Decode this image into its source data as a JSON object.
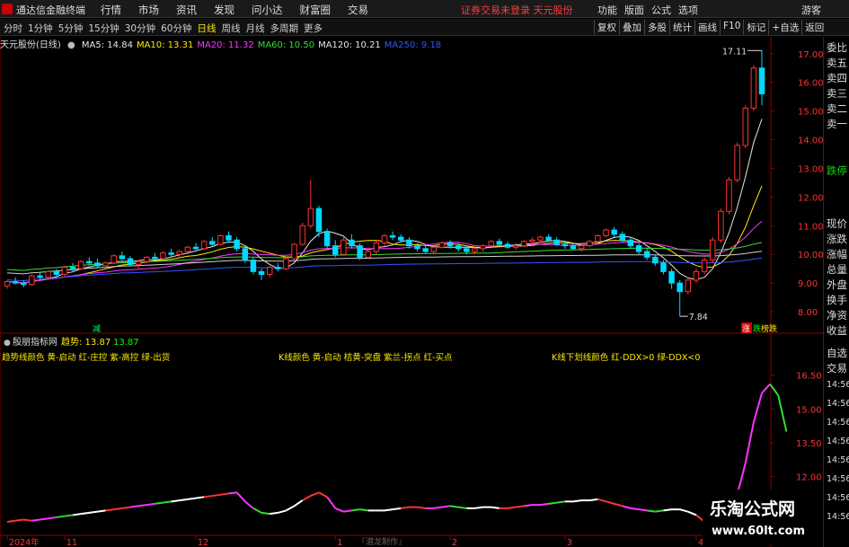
{
  "titlebar": {
    "app_name": "通达信金融终端",
    "menu": [
      "行情",
      "市场",
      "资讯",
      "发现",
      "问小达",
      "财富圈",
      "交易"
    ],
    "notice": "证券交易未登录 天元股份",
    "right_menu": [
      "功能",
      "版面",
      "公式",
      "选项"
    ],
    "guest": "游客"
  },
  "periodbar": {
    "periods": [
      "分时",
      "1分钟",
      "5分钟",
      "15分钟",
      "30分钟",
      "60分钟",
      "日线",
      "周线",
      "月线",
      "多周期",
      "更多"
    ],
    "active_period": "日线",
    "right_buttons": [
      "复权",
      "叠加",
      "多股",
      "统计",
      "画线",
      "F10",
      "标记",
      "+自选",
      "返回"
    ]
  },
  "main_header": {
    "stock": "天元股份(日线)",
    "ma": [
      {
        "label": "MA5: 14.84",
        "color": "#e6e6e6"
      },
      {
        "label": "MA10: 13.31",
        "color": "#ffea00"
      },
      {
        "label": "MA20: 11.32",
        "color": "#ff33ff"
      },
      {
        "label": "MA60: 10.50",
        "color": "#33dd33"
      },
      {
        "label": "MA120: 10.21",
        "color": "#e6e6e6"
      },
      {
        "label": "MA250: 9.18",
        "color": "#3355ff"
      }
    ]
  },
  "price_axis": {
    "ticks": [
      "17.00",
      "16.00",
      "15.00",
      "14.00",
      "13.00",
      "12.00",
      "11.00",
      "10.00",
      "9.00",
      "8.00"
    ],
    "high_label": "17.11",
    "low_label": "7.84"
  },
  "price_chart_labels": {
    "bottom_marker": "减",
    "tags": [
      "涨",
      "跌",
      "榜跌"
    ]
  },
  "indicator": {
    "header_name": "殷朋指标网",
    "trend_label": "趋势: 13.87",
    "trend_value2": "13.87",
    "legend1": "趋势线颜色 黄-启动 红-庄控 紫-高控 绿-出货",
    "legend2": "K线颜色 黄-启动 桔黄-突盘 紫兰-拐点 红-买点",
    "legend3": "K线下划线颜色 红-DDX>0 绿-DDX<0",
    "ticks": [
      "16.50",
      "15.00",
      "13.50",
      "12.00",
      "10.50"
    ],
    "watermark": "『潜龙制作』"
  },
  "date_axis": {
    "labels": [
      "2024年",
      "11",
      "12",
      "1",
      "2",
      "3",
      "4"
    ]
  },
  "side_panel": {
    "top": [
      "委比",
      "卖五",
      "卖四",
      "卖三",
      "卖二",
      "卖一"
    ],
    "mid": "跌停",
    "stats": [
      "现价",
      "涨跌",
      "涨幅",
      "总量",
      "外盘",
      "换手",
      "净资",
      "收益"
    ],
    "lower": [
      "自选",
      "交易"
    ],
    "times": [
      "14:56",
      "14:56",
      "14:56",
      "14:56",
      "14:56",
      "14:56",
      "14:56",
      "14:56"
    ]
  },
  "site_watermark": {
    "name": "乐淘公式网",
    "url": "www.60lt.com"
  },
  "chart_data": {
    "type": "candlestick",
    "dates_start": "2024-10",
    "candles": [
      [
        8.9,
        9.1,
        8.8,
        9.05
      ],
      [
        9.05,
        9.2,
        8.95,
        9.0
      ],
      [
        9.0,
        9.1,
        8.85,
        8.95
      ],
      [
        8.95,
        9.3,
        8.9,
        9.25
      ],
      [
        9.25,
        9.4,
        9.1,
        9.2
      ],
      [
        9.2,
        9.45,
        9.1,
        9.4
      ],
      [
        9.4,
        9.5,
        9.2,
        9.3
      ],
      [
        9.3,
        9.6,
        9.25,
        9.55
      ],
      [
        9.55,
        9.7,
        9.4,
        9.5
      ],
      [
        9.5,
        9.8,
        9.45,
        9.75
      ],
      [
        9.75,
        9.9,
        9.6,
        9.7
      ],
      [
        9.7,
        9.85,
        9.55,
        9.6
      ],
      [
        9.6,
        9.75,
        9.5,
        9.7
      ],
      [
        9.7,
        10.0,
        9.65,
        9.95
      ],
      [
        9.95,
        10.1,
        9.8,
        9.85
      ],
      [
        9.85,
        9.95,
        9.6,
        9.65
      ],
      [
        9.65,
        9.8,
        9.5,
        9.75
      ],
      [
        9.75,
        9.95,
        9.7,
        9.9
      ],
      [
        9.9,
        10.05,
        9.8,
        9.85
      ],
      [
        9.85,
        10.1,
        9.8,
        10.05
      ],
      [
        10.05,
        10.2,
        9.9,
        10.0
      ],
      [
        10.0,
        10.15,
        9.85,
        10.1
      ],
      [
        10.1,
        10.3,
        10.0,
        10.25
      ],
      [
        10.25,
        10.4,
        10.1,
        10.2
      ],
      [
        10.2,
        10.5,
        10.15,
        10.45
      ],
      [
        10.45,
        10.6,
        10.3,
        10.35
      ],
      [
        10.35,
        10.7,
        10.3,
        10.65
      ],
      [
        10.65,
        10.8,
        10.4,
        10.5
      ],
      [
        10.5,
        10.6,
        10.1,
        10.2
      ],
      [
        10.2,
        10.3,
        9.7,
        9.8
      ],
      [
        9.8,
        9.9,
        9.3,
        9.4
      ],
      [
        9.4,
        9.5,
        9.1,
        9.3
      ],
      [
        9.3,
        9.6,
        9.2,
        9.55
      ],
      [
        9.55,
        9.7,
        9.4,
        9.5
      ],
      [
        9.5,
        9.9,
        9.45,
        9.85
      ],
      [
        9.85,
        10.4,
        9.8,
        10.35
      ],
      [
        10.35,
        11.1,
        10.3,
        11.0
      ],
      [
        11.0,
        12.6,
        10.9,
        11.6
      ],
      [
        11.6,
        11.7,
        10.6,
        10.8
      ],
      [
        10.8,
        10.9,
        10.2,
        10.3
      ],
      [
        10.3,
        10.5,
        9.9,
        10.0
      ],
      [
        10.0,
        10.6,
        9.95,
        10.5
      ],
      [
        10.5,
        10.7,
        10.2,
        10.3
      ],
      [
        10.3,
        10.4,
        9.8,
        9.9
      ],
      [
        9.9,
        10.2,
        9.85,
        10.1
      ],
      [
        10.1,
        10.5,
        10.0,
        10.4
      ],
      [
        10.4,
        10.7,
        10.3,
        10.65
      ],
      [
        10.65,
        10.8,
        10.5,
        10.6
      ],
      [
        10.6,
        10.7,
        10.4,
        10.5
      ],
      [
        10.5,
        10.6,
        10.2,
        10.3
      ],
      [
        10.3,
        10.4,
        10.1,
        10.2
      ],
      [
        10.2,
        10.35,
        10.05,
        10.1
      ],
      [
        10.1,
        10.3,
        10.0,
        10.25
      ],
      [
        10.25,
        10.45,
        10.2,
        10.4
      ],
      [
        10.4,
        10.5,
        10.2,
        10.3
      ],
      [
        10.3,
        10.4,
        10.1,
        10.2
      ],
      [
        10.2,
        10.3,
        10.0,
        10.1
      ],
      [
        10.1,
        10.25,
        10.0,
        10.2
      ],
      [
        10.2,
        10.35,
        10.1,
        10.3
      ],
      [
        10.3,
        10.5,
        10.25,
        10.45
      ],
      [
        10.45,
        10.55,
        10.3,
        10.35
      ],
      [
        10.35,
        10.45,
        10.2,
        10.25
      ],
      [
        10.25,
        10.4,
        10.15,
        10.3
      ],
      [
        10.3,
        10.5,
        10.25,
        10.45
      ],
      [
        10.45,
        10.6,
        10.35,
        10.5
      ],
      [
        10.5,
        10.65,
        10.4,
        10.6
      ],
      [
        10.6,
        10.7,
        10.45,
        10.5
      ],
      [
        10.5,
        10.6,
        10.3,
        10.35
      ],
      [
        10.35,
        10.45,
        10.2,
        10.3
      ],
      [
        10.3,
        10.4,
        10.15,
        10.2
      ],
      [
        10.2,
        10.35,
        10.1,
        10.3
      ],
      [
        10.3,
        10.5,
        10.25,
        10.45
      ],
      [
        10.45,
        10.7,
        10.4,
        10.65
      ],
      [
        10.65,
        10.9,
        10.6,
        10.85
      ],
      [
        10.85,
        10.95,
        10.6,
        10.7
      ],
      [
        10.7,
        10.8,
        10.4,
        10.5
      ],
      [
        10.5,
        10.6,
        10.2,
        10.3
      ],
      [
        10.3,
        10.4,
        10.0,
        10.1
      ],
      [
        10.1,
        10.2,
        9.8,
        9.9
      ],
      [
        9.9,
        10.0,
        9.6,
        9.7
      ],
      [
        9.7,
        9.8,
        9.3,
        9.4
      ],
      [
        9.4,
        9.5,
        8.8,
        9.0
      ],
      [
        9.0,
        9.1,
        7.84,
        8.7
      ],
      [
        8.7,
        9.2,
        8.6,
        9.1
      ],
      [
        9.1,
        9.5,
        9.0,
        9.4
      ],
      [
        9.4,
        9.9,
        9.3,
        9.8
      ],
      [
        9.8,
        10.6,
        9.7,
        10.5
      ],
      [
        10.5,
        11.6,
        10.4,
        11.5
      ],
      [
        11.5,
        12.7,
        11.4,
        12.6
      ],
      [
        12.6,
        13.9,
        12.5,
        13.8
      ],
      [
        13.8,
        15.2,
        13.7,
        15.1
      ],
      [
        15.1,
        16.6,
        15.0,
        16.5
      ],
      [
        16.5,
        17.11,
        15.2,
        15.6
      ]
    ],
    "ma_values": {
      "MA5": 14.84,
      "MA10": 13.31,
      "MA20": 11.32,
      "MA60": 10.5,
      "MA120": 10.21,
      "MA250": 9.18
    },
    "ylim": [
      7.5,
      17.4
    ],
    "indicator_series": [
      10.0,
      10.05,
      10.1,
      10.05,
      10.1,
      10.15,
      10.2,
      10.25,
      10.3,
      10.35,
      10.4,
      10.45,
      10.5,
      10.55,
      10.6,
      10.65,
      10.7,
      10.75,
      10.8,
      10.85,
      10.9,
      10.95,
      11.0,
      11.05,
      11.1,
      11.15,
      11.2,
      11.25,
      11.3,
      10.9,
      10.6,
      10.4,
      10.35,
      10.4,
      10.5,
      10.7,
      10.95,
      11.15,
      11.3,
      11.1,
      10.6,
      10.45,
      10.5,
      10.55,
      10.5,
      10.5,
      10.5,
      10.55,
      10.6,
      10.65,
      10.65,
      10.6,
      10.6,
      10.65,
      10.7,
      10.65,
      10.6,
      10.6,
      10.65,
      10.65,
      10.6,
      10.6,
      10.65,
      10.7,
      10.75,
      10.75,
      10.8,
      10.85,
      10.9,
      10.9,
      10.95,
      10.95,
      11.0,
      10.9,
      10.8,
      10.7,
      10.6,
      10.55,
      10.5,
      10.45,
      10.5,
      10.55,
      10.55,
      10.45,
      10.3,
      10.0,
      10.1,
      10.2,
      10.5,
      11.2,
      12.6,
      14.4,
      15.7,
      16.1,
      15.6,
      14.0
    ],
    "indicator_ylim": [
      9.8,
      17.0
    ]
  }
}
